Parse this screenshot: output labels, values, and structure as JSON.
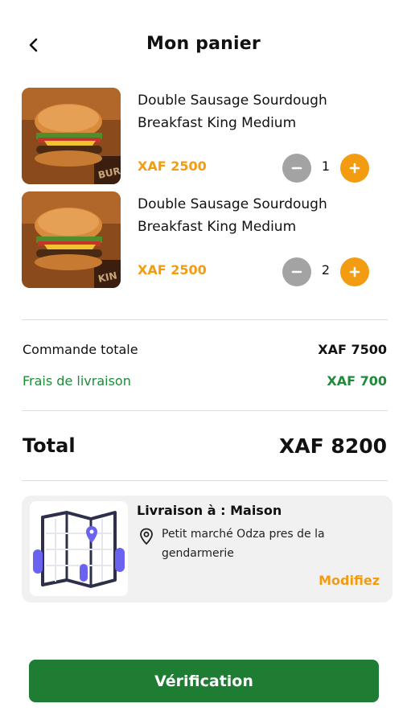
{
  "header": {
    "title": "Mon panier",
    "back_icon": "chevron-left-icon"
  },
  "cart": {
    "items": [
      {
        "name": "Double Sausage Sourdough Breakfast King Medium",
        "price": "XAF 2500",
        "quantity": "1"
      },
      {
        "name": "Double Sausage Sourdough Breakfast King Medium",
        "price": "XAF 2500",
        "quantity": "2"
      }
    ]
  },
  "summary": {
    "subtotal_label": "Commande  totale",
    "subtotal_value": "XAF 7500",
    "delivery_fee_label": "Frais de livraison",
    "delivery_fee_value": "XAF 700",
    "total_label": "Total",
    "total_value": "XAF 8200"
  },
  "delivery": {
    "title": "Livraison à : Maison",
    "address": "Petit marché Odza pres de la gendarmerie",
    "modify_label": "Modifiez",
    "icon": "map-icon",
    "pin_icon": "location-pin-icon"
  },
  "actions": {
    "verify_label": "Vérification"
  },
  "colors": {
    "accent_orange": "#f39c12",
    "brand_green": "#1e7d33",
    "fee_green": "#1e8a3a",
    "minus_gray": "#a3a3a3",
    "card_bg": "#f1f1f1"
  }
}
